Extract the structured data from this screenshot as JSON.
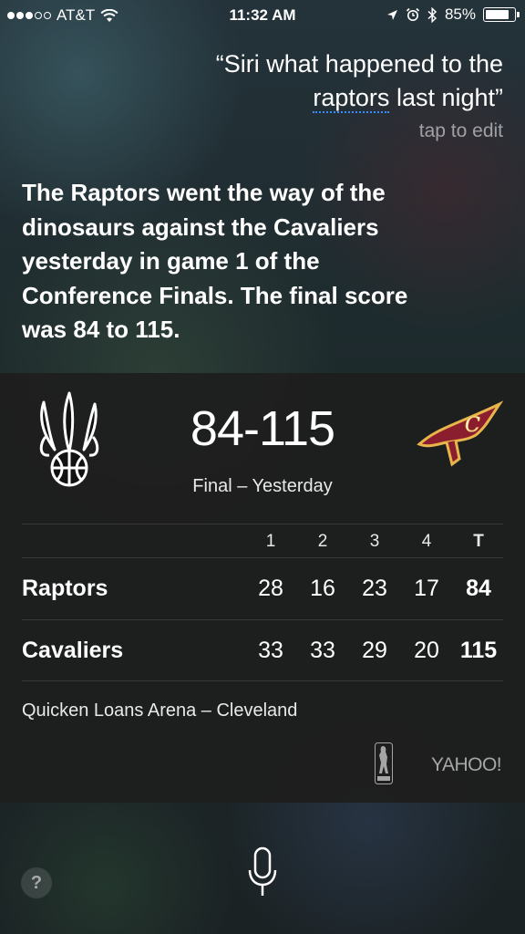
{
  "status_bar": {
    "carrier": "AT&T",
    "time": "11:32 AM",
    "battery_percent": "85%",
    "battery_level": 0.85
  },
  "siri": {
    "query_line1": "“Siri what happened to the",
    "query_word": "raptors",
    "query_line2_rest": " last night”",
    "tap_to_edit": "tap to edit",
    "answer": "The Raptors went the way of the dinosaurs against the Cavaliers yesterday in game 1 of the Conference Finals. The final score was 84 to 115."
  },
  "card": {
    "score": "84-115",
    "status": "Final – Yesterday",
    "headers": [
      "1",
      "2",
      "3",
      "4",
      "T"
    ],
    "teams": [
      {
        "name": "Raptors",
        "quarters": [
          "28",
          "16",
          "23",
          "17"
        ],
        "total": "84"
      },
      {
        "name": "Cavaliers",
        "quarters": [
          "33",
          "33",
          "29",
          "20"
        ],
        "total": "115"
      }
    ],
    "venue": "Quicken Loans Arena – Cleveland",
    "source": "YAHOO!"
  },
  "bottom": {
    "help_label": "?"
  },
  "colors": {
    "link_underline": "#3a8cff",
    "cavs_wine": "#8b1e2e",
    "cavs_gold": "#e8b54a"
  },
  "icons": [
    "wifi-icon",
    "location-icon",
    "alarm-icon",
    "bluetooth-icon",
    "battery-icon",
    "raptors-logo",
    "cavaliers-logo",
    "nba-logo",
    "microphone-icon",
    "help-icon"
  ]
}
